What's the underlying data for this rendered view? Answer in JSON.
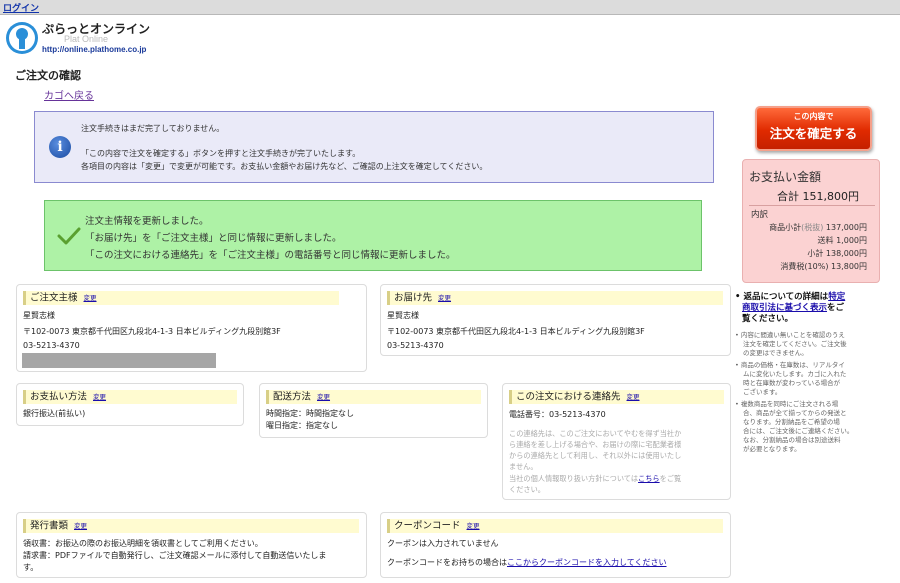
{
  "topbar": {
    "login_link": "ログイン"
  },
  "brand": {
    "name": "ぷらっとオンライン",
    "sub": "Plat Online",
    "url": "http://online.plathome.co.jp"
  },
  "page": {
    "title": "ご注文の確認",
    "back_link": "カゴへ戻る"
  },
  "info": {
    "line1": "注文手続きはまだ完了しておりません。",
    "line2": "「この内容で注文を確定する」ボタンを押すと注文手続きが完了いたします。",
    "line3": "各項目の内容は「変更」で変更が可能です。お支払い金額やお届け先など、ご確認の上注文を確定してください。"
  },
  "success": {
    "line1": "注文主情報を更新しました。",
    "line2": "「お届け先」を「ご注文主様」と同じ情報に更新しました。",
    "line3": "「この注文における連絡先」を「ご注文主様」の電話番号と同じ情報に更新しました。"
  },
  "confirm_button": {
    "line1": "この内容で",
    "line2": "注文を確定する"
  },
  "payment": {
    "title": "お支払い金額",
    "total_label": "合計",
    "total_value": "151,800円",
    "breakdown_label": "内訳",
    "subtotal_label": "商品小計",
    "subtotal_note": "(税抜)",
    "subtotal_value": "137,000円",
    "shipping_label": "送料",
    "shipping_value": "1,000円",
    "pretax_label": "小計",
    "pretax_value": "138,000円",
    "tax_label": "消費税",
    "tax_note": "(10%)",
    "tax_value": "13,800円"
  },
  "orderer": {
    "title": "ご注文主様",
    "edit": "変更",
    "name": "星賢志様",
    "address": "〒102-0073 東京都千代田区九段北4-1-3 日本ビルディング九段別館3F",
    "phone": "03-5213-4370"
  },
  "delivery": {
    "title": "お届け先",
    "edit": "変更",
    "name": "星賢志様",
    "address": "〒102-0073 東京都千代田区九段北4-1-3 日本ビルディング九段別館3F",
    "phone": "03-5213-4370"
  },
  "payment_method": {
    "title": "お支払い方法",
    "edit": "変更",
    "value": "銀行振込(前払い)"
  },
  "shipping_method": {
    "title": "配送方法",
    "edit": "変更",
    "time": "時間指定：時間指定なし",
    "day": "曜日指定：指定なし"
  },
  "contact": {
    "title": "この注文における連絡先",
    "edit": "変更",
    "phone": "電話番号：03-5213-4370",
    "note1": "この連絡先は、このご注文においてやむを得ず当社か",
    "note2": "ら連絡を差し上げる場合や、お届けの際に宅配業者様",
    "note3": "からの連絡先として利用し、それ以外には使用いたし",
    "note4": "ません。",
    "note5_pre": "当社の個人情報取り扱い方針については",
    "note5_link": "こちら",
    "note5_post": "をご覧",
    "note6": "ください。"
  },
  "invoice": {
    "title": "発行書類",
    "edit": "変更",
    "line1": "領収書：お振込の際のお振込明細を領収書としてご利用ください。",
    "line2": "請求書：PDFファイルで自動発行し、ご注文確認メールに添付して自動送信いたしま",
    "line3": "す。"
  },
  "coupon": {
    "title": "クーポンコード",
    "edit": "変更",
    "status": "クーポンは入力されていません",
    "prompt": "クーポンコードをお持ちの場合は",
    "link": "ここからクーポンコードを入力してください"
  },
  "side": {
    "lead_pre": "返品についての詳細は",
    "lead_link1": "特定",
    "lead_link2": "商取引法に基づく表示",
    "lead_post1": "をご",
    "lead_post2": "覧ください。",
    "notes": [
      "内容に間違い無いことを確認のうえ",
      "注文を確定してください。ご注文後",
      "の変更はできません。",
      "商品の価格・在庫数は、リアルタイ",
      "ムに変化いたします。カゴに入れた",
      "時と在庫数が変わっている場合が",
      "ございます。",
      "複数商品を同時にご注文される場",
      "合、商品が全て揃ってからの発送と",
      "なります。分割納品をご希望の場",
      "合には、ご注文後にご連絡ください。",
      "なお、分割納品の場合は別途送料",
      "が必要となります。"
    ]
  }
}
